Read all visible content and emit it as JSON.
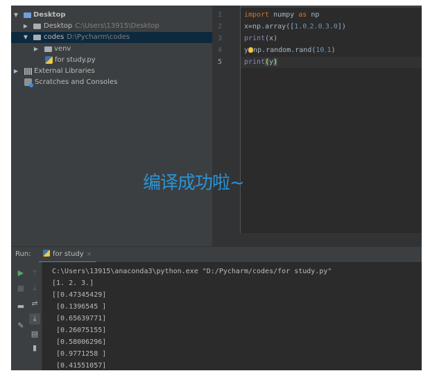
{
  "project_tree": {
    "items": [
      {
        "name": "Desktop",
        "path": ""
      },
      {
        "name": "Desktop",
        "path": "C:\\Users\\13915\\Desktop"
      },
      {
        "name": "codes",
        "path": "D:\\Pycharm\\codes"
      },
      {
        "name": "venv",
        "path": ""
      },
      {
        "name": "for study.py",
        "path": ""
      },
      {
        "name": "External Libraries",
        "path": ""
      },
      {
        "name": "Scratches and Consoles",
        "path": ""
      }
    ]
  },
  "editor": {
    "line_numbers": [
      "1",
      "2",
      "3",
      "4",
      "5"
    ],
    "lines": {
      "l1": {
        "kw1": "import",
        "t1": " numpy ",
        "kw2": "as",
        "t2": " np"
      },
      "l2": {
        "t1": "x=np.array([",
        "n1": "1.0",
        "h1": ",",
        "n2": "2.0",
        "h2": ",",
        "n3": "3.0",
        "t2": "])"
      },
      "l3": {
        "fn": "print",
        "t1": "(x)"
      },
      "l4": {
        "t1": "y",
        "t2": "np.random.rand(",
        "n1": "10",
        "h1": ",",
        "n2": "1",
        "t3": ")"
      },
      "l5": {
        "fn": "print",
        "p1": "(",
        "t1": "y",
        "p2": ")"
      }
    }
  },
  "overlay": {
    "text": "编译成功啦~"
  },
  "run": {
    "label": "Run:",
    "tab_label": "for study",
    "tab_close": "×",
    "output": [
      "C:\\Users\\13915\\anaconda3\\python.exe \"D:/Pycharm/codes/for study.py\"",
      "[1. 2. 3.]",
      "[[0.47345429]",
      " [0.1396545 ]",
      " [0.65639771]",
      " [0.26075155]",
      " [0.58006296]",
      " [0.9771258 ]",
      " [0.41551057]"
    ]
  },
  "icons": {
    "run": "play-icon",
    "up": "arrow-up-icon",
    "stop": "stop-icon",
    "down": "arrow-down-icon",
    "layout": "layout-icon",
    "soft_wrap": "soft-wrap-icon",
    "pin": "pin-icon",
    "scroll_end": "scroll-to-end-icon",
    "print": "print-icon",
    "trash": "trash-icon"
  },
  "colors": {
    "overlay_text": "#2a93d5",
    "keyword": "#cc7832",
    "builtin": "#8888c6",
    "number": "#6897bb",
    "run_green": "#59a869"
  }
}
